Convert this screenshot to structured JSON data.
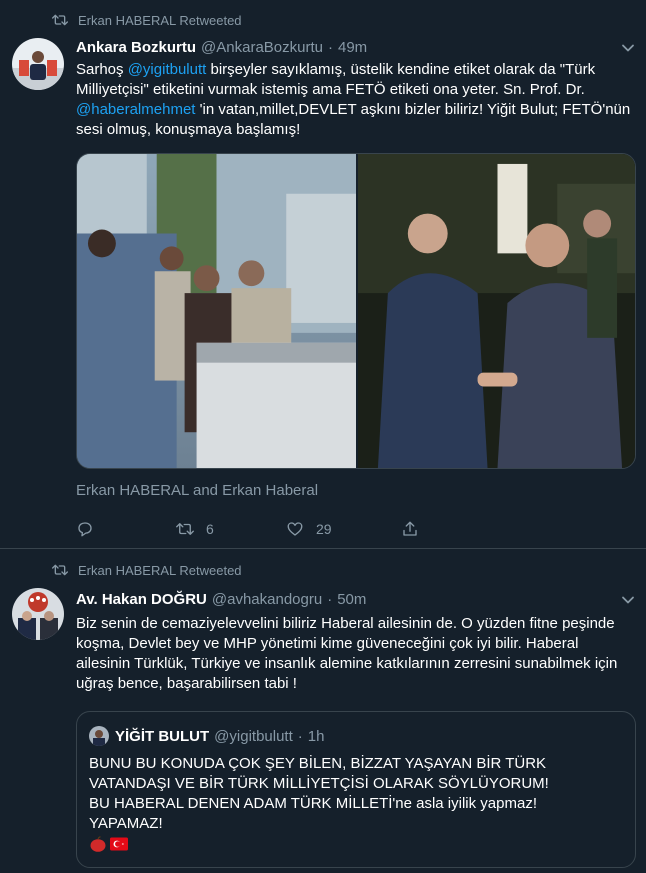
{
  "tweets": [
    {
      "retweeted_by": "Erkan HABERAL Retweeted",
      "name": "Ankara Bozkurtu",
      "handle": "@AnkaraBozkurtu",
      "dot": "·",
      "time": "49m",
      "text": {
        "p1": "Sarhoş ",
        "m1": "@yigitbulutt",
        "p2": " birşeyler sayıklamış, üstelik kendine etiket olarak da \"Türk Milliyetçisi\" etiketini vurmak istemiş ama FETÖ etiketi ona yeter. Sn. Prof. Dr. ",
        "m2": "@haberalmehmet",
        "p3": " 'in vatan,millet,DEVLET aşkını bizler biliriz! Yiğit Bulut; FETÖ'nün sesi olmuş, konuşmaya başlamış!"
      },
      "tagged": "Erkan HABERAL and Erkan Haberal",
      "actions": {
        "reply_count": "",
        "retweet_count": "6",
        "like_count": "29"
      }
    },
    {
      "retweeted_by": "Erkan HABERAL Retweeted",
      "name": "Av. Hakan DOĞRU",
      "handle": "@avhakandogru",
      "dot": "·",
      "time": "50m",
      "text": "Biz senin de cemaziyelevvelini biliriz Haberal ailesinin de. O yüzden fitne peşinde koşma, Devlet bey ve MHP yönetimi kime güveneceğini çok iyi bilir. Haberal ailesinin Türklük, Türkiye ve insanlık alemine katkılarının zerresini sunabilmek için uğraş bence, başarabilirsen tabi !",
      "quote": {
        "name": "YİĞİT BULUT",
        "handle": "@yigitbulutt",
        "dot": "·",
        "time": "1h",
        "line1": "BUNU BU KONUDA ÇOK ŞEY BİLEN, BİZZAT YAŞAYAN BİR TÜRK",
        "line2": "VATANDAŞI VE BİR TÜRK MİLLİYETÇİSİ OLARAK SÖYLÜYORUM!",
        "line3": "BU HABERAL DENEN ADAM TÜRK MİLLETİ'ne asla iyilik yapmaz!",
        "line4": "YAPAMAZ!",
        "emojis": [
          "apple",
          "turkish-flag"
        ]
      }
    }
  ],
  "colors": {
    "background": "#15202b",
    "border": "#38444d",
    "secondary_text": "#8899a6",
    "link": "#1da1f2",
    "primary_text": "#ffffff"
  }
}
